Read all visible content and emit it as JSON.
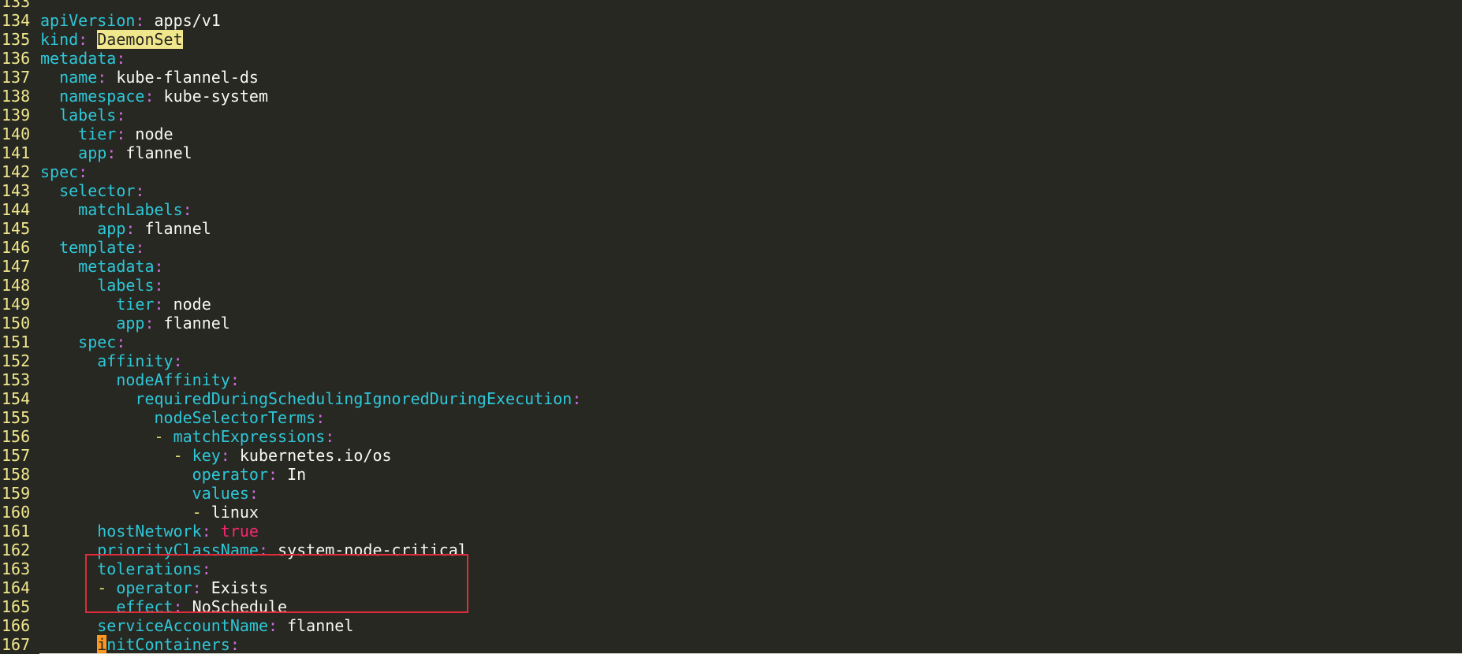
{
  "editor": {
    "lines": [
      {
        "n": "133",
        "indent": 0,
        "tokens": []
      },
      {
        "n": "134",
        "indent": 0,
        "tokens": [
          {
            "t": "apiVersion",
            "c": "key"
          },
          {
            "t": ":",
            "c": "colon"
          },
          {
            "t": " apps/v1",
            "c": "val"
          }
        ]
      },
      {
        "n": "135",
        "indent": 0,
        "tokens": [
          {
            "t": "kind",
            "c": "key"
          },
          {
            "t": ":",
            "c": "colon"
          },
          {
            "t": " ",
            "c": "val"
          },
          {
            "t": "DaemonSet",
            "c": "search"
          }
        ]
      },
      {
        "n": "136",
        "indent": 0,
        "tokens": [
          {
            "t": "metadata",
            "c": "key"
          },
          {
            "t": ":",
            "c": "colon"
          }
        ]
      },
      {
        "n": "137",
        "indent": 2,
        "tokens": [
          {
            "t": "name",
            "c": "key"
          },
          {
            "t": ":",
            "c": "colon"
          },
          {
            "t": " kube-flannel-ds",
            "c": "val"
          }
        ]
      },
      {
        "n": "138",
        "indent": 2,
        "tokens": [
          {
            "t": "namespace",
            "c": "key"
          },
          {
            "t": ":",
            "c": "colon"
          },
          {
            "t": " kube-system",
            "c": "val"
          }
        ]
      },
      {
        "n": "139",
        "indent": 2,
        "tokens": [
          {
            "t": "labels",
            "c": "key"
          },
          {
            "t": ":",
            "c": "colon"
          }
        ]
      },
      {
        "n": "140",
        "indent": 4,
        "tokens": [
          {
            "t": "tier",
            "c": "key"
          },
          {
            "t": ":",
            "c": "colon"
          },
          {
            "t": " node",
            "c": "val"
          }
        ]
      },
      {
        "n": "141",
        "indent": 4,
        "tokens": [
          {
            "t": "app",
            "c": "key"
          },
          {
            "t": ":",
            "c": "colon"
          },
          {
            "t": " flannel",
            "c": "val"
          }
        ]
      },
      {
        "n": "142",
        "indent": 0,
        "tokens": [
          {
            "t": "spec",
            "c": "key"
          },
          {
            "t": ":",
            "c": "colon"
          }
        ]
      },
      {
        "n": "143",
        "indent": 2,
        "tokens": [
          {
            "t": "selector",
            "c": "key"
          },
          {
            "t": ":",
            "c": "colon"
          }
        ]
      },
      {
        "n": "144",
        "indent": 4,
        "tokens": [
          {
            "t": "matchLabels",
            "c": "key"
          },
          {
            "t": ":",
            "c": "colon"
          }
        ]
      },
      {
        "n": "145",
        "indent": 6,
        "tokens": [
          {
            "t": "app",
            "c": "key"
          },
          {
            "t": ":",
            "c": "colon"
          },
          {
            "t": " flannel",
            "c": "val"
          }
        ]
      },
      {
        "n": "146",
        "indent": 2,
        "tokens": [
          {
            "t": "template",
            "c": "key"
          },
          {
            "t": ":",
            "c": "colon"
          }
        ]
      },
      {
        "n": "147",
        "indent": 4,
        "tokens": [
          {
            "t": "metadata",
            "c": "key"
          },
          {
            "t": ":",
            "c": "colon"
          }
        ]
      },
      {
        "n": "148",
        "indent": 6,
        "tokens": [
          {
            "t": "labels",
            "c": "key"
          },
          {
            "t": ":",
            "c": "colon"
          }
        ]
      },
      {
        "n": "149",
        "indent": 8,
        "tokens": [
          {
            "t": "tier",
            "c": "key"
          },
          {
            "t": ":",
            "c": "colon"
          },
          {
            "t": " node",
            "c": "val"
          }
        ]
      },
      {
        "n": "150",
        "indent": 8,
        "tokens": [
          {
            "t": "app",
            "c": "key"
          },
          {
            "t": ":",
            "c": "colon"
          },
          {
            "t": " flannel",
            "c": "val"
          }
        ]
      },
      {
        "n": "151",
        "indent": 4,
        "tokens": [
          {
            "t": "spec",
            "c": "key"
          },
          {
            "t": ":",
            "c": "colon"
          }
        ]
      },
      {
        "n": "152",
        "indent": 6,
        "tokens": [
          {
            "t": "affinity",
            "c": "key"
          },
          {
            "t": ":",
            "c": "colon"
          }
        ]
      },
      {
        "n": "153",
        "indent": 8,
        "tokens": [
          {
            "t": "nodeAffinity",
            "c": "key"
          },
          {
            "t": ":",
            "c": "colon"
          }
        ]
      },
      {
        "n": "154",
        "indent": 10,
        "tokens": [
          {
            "t": "requiredDuringSchedulingIgnoredDuringExecution",
            "c": "key"
          },
          {
            "t": ":",
            "c": "colon"
          }
        ]
      },
      {
        "n": "155",
        "indent": 12,
        "tokens": [
          {
            "t": "nodeSelectorTerms",
            "c": "key"
          },
          {
            "t": ":",
            "c": "colon"
          }
        ]
      },
      {
        "n": "156",
        "indent": 12,
        "tokens": [
          {
            "t": "- ",
            "c": "dash"
          },
          {
            "t": "matchExpressions",
            "c": "key"
          },
          {
            "t": ":",
            "c": "colon"
          }
        ]
      },
      {
        "n": "157",
        "indent": 14,
        "tokens": [
          {
            "t": "- ",
            "c": "dash"
          },
          {
            "t": "key",
            "c": "key"
          },
          {
            "t": ":",
            "c": "colon"
          },
          {
            "t": " kubernetes.io/os",
            "c": "val"
          }
        ]
      },
      {
        "n": "158",
        "indent": 16,
        "tokens": [
          {
            "t": "operator",
            "c": "key"
          },
          {
            "t": ":",
            "c": "colon"
          },
          {
            "t": " In",
            "c": "val"
          }
        ]
      },
      {
        "n": "159",
        "indent": 16,
        "tokens": [
          {
            "t": "values",
            "c": "key"
          },
          {
            "t": ":",
            "c": "colon"
          }
        ]
      },
      {
        "n": "160",
        "indent": 16,
        "tokens": [
          {
            "t": "- ",
            "c": "dash"
          },
          {
            "t": "linux",
            "c": "val"
          }
        ]
      },
      {
        "n": "161",
        "indent": 6,
        "tokens": [
          {
            "t": "hostNetwork",
            "c": "key"
          },
          {
            "t": ":",
            "c": "colon"
          },
          {
            "t": " ",
            "c": "val"
          },
          {
            "t": "true",
            "c": "bool"
          }
        ]
      },
      {
        "n": "162",
        "indent": 6,
        "tokens": [
          {
            "t": "priorityClassName",
            "c": "key"
          },
          {
            "t": ":",
            "c": "colon"
          },
          {
            "t": " system-node-critical",
            "c": "val"
          }
        ]
      },
      {
        "n": "163",
        "indent": 6,
        "tokens": [
          {
            "t": "tolerations",
            "c": "key"
          },
          {
            "t": ":",
            "c": "colon"
          }
        ]
      },
      {
        "n": "164",
        "indent": 6,
        "tokens": [
          {
            "t": "- ",
            "c": "dash"
          },
          {
            "t": "operator",
            "c": "key"
          },
          {
            "t": ":",
            "c": "colon"
          },
          {
            "t": " Exists",
            "c": "val"
          }
        ]
      },
      {
        "n": "165",
        "indent": 8,
        "tokens": [
          {
            "t": "effect",
            "c": "key"
          },
          {
            "t": ":",
            "c": "colon"
          },
          {
            "t": " NoSchedule",
            "c": "val"
          }
        ]
      },
      {
        "n": "166",
        "indent": 6,
        "tokens": [
          {
            "t": "serviceAccountName",
            "c": "key"
          },
          {
            "t": ":",
            "c": "colon"
          },
          {
            "t": " flannel",
            "c": "val"
          }
        ]
      },
      {
        "n": "167",
        "indent": 6,
        "cursorline": true,
        "tokens": [
          {
            "t": "i",
            "c": "cursor"
          },
          {
            "t": "nitContainers",
            "c": "key"
          },
          {
            "t": ":",
            "c": "colon"
          }
        ]
      }
    ]
  },
  "colors": {
    "background": "#272822",
    "key": "#2ec7d8",
    "colon": "#cf6de0",
    "value": "#f8f8f2",
    "line_number": "#f0e68c",
    "search_highlight": "#f0e68c",
    "cursor": "#fd971f",
    "boolean": "#f92672",
    "annotation_box": "#e02b3a"
  }
}
